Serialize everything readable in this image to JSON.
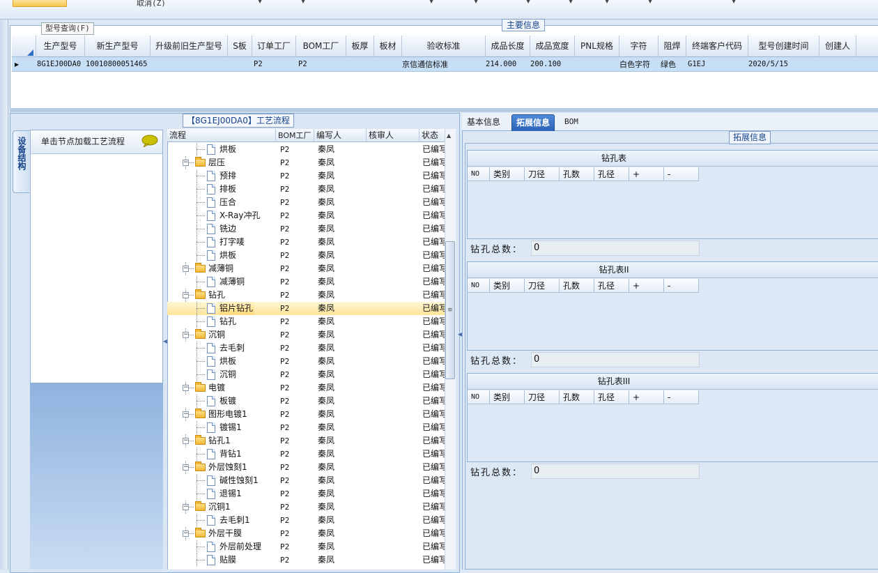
{
  "toolbar": {
    "cancel_label": "取消(Z)"
  },
  "main_group": {
    "title": "主要信息",
    "query_tab": "型号查询(F)",
    "columns": [
      "生产型号",
      "新生产型号",
      "升级前旧生产型号",
      "S板",
      "订单工厂",
      "BOM工厂",
      "板厚",
      "板材",
      "验收标准",
      "成品长度",
      "成品宽度",
      "PNL规格",
      "字符",
      "阻焊",
      "终端客户代码",
      "型号创建时间",
      "创建人"
    ],
    "row": {
      "prod_model": "8G1EJ00DA0",
      "new_model": "10010800051465",
      "old_model": "",
      "s_board": "",
      "order_factory": "P2",
      "bom_factory": "P2",
      "thickness": "",
      "material": "",
      "standard": "京信通信标准",
      "length": "214.000",
      "width": "200.100",
      "pnl": "",
      "char": "白色字符",
      "mask": "绿色",
      "customer": "G1EJ",
      "created": "2020/5/15",
      "creator": ""
    }
  },
  "left_panel": {
    "flow_title": "【8G1EJ00DA0】工艺流程",
    "vertical_tab": "设备结构",
    "node_hint": "单击节点加载工艺流程"
  },
  "tree": {
    "columns": [
      "流程",
      "BOM工厂",
      "编写人",
      "核审人",
      "状态"
    ],
    "rows": [
      {
        "name": "烘板",
        "level": 2,
        "bom": "P2",
        "author": "秦凤",
        "status": "已编写"
      },
      {
        "name": "层压",
        "level": 1,
        "bom": "P2",
        "author": "秦凤",
        "status": "已编写"
      },
      {
        "name": "预排",
        "level": 2,
        "bom": "P2",
        "author": "秦凤",
        "status": "已编写"
      },
      {
        "name": "排板",
        "level": 2,
        "bom": "P2",
        "author": "秦凤",
        "status": "已编写"
      },
      {
        "name": "压合",
        "level": 2,
        "bom": "P2",
        "author": "秦凤",
        "status": "已编写"
      },
      {
        "name": "X-Ray冲孔",
        "level": 2,
        "bom": "P2",
        "author": "秦凤",
        "status": "已编写"
      },
      {
        "name": "铣边",
        "level": 2,
        "bom": "P2",
        "author": "秦凤",
        "status": "已编写"
      },
      {
        "name": "打字唛",
        "level": 2,
        "bom": "P2",
        "author": "秦凤",
        "status": "已编写"
      },
      {
        "name": "烘板",
        "level": 2,
        "bom": "P2",
        "author": "秦凤",
        "status": "已编写"
      },
      {
        "name": "减薄铜",
        "level": 1,
        "bom": "P2",
        "author": "秦凤",
        "status": "已编写"
      },
      {
        "name": "减薄铜",
        "level": 2,
        "bom": "P2",
        "author": "秦凤",
        "status": "已编写"
      },
      {
        "name": "钻孔",
        "level": 1,
        "bom": "P2",
        "author": "秦凤",
        "status": "已编写"
      },
      {
        "name": "铝片钻孔",
        "level": 2,
        "bom": "P2",
        "author": "秦凤",
        "status": "已编写",
        "selected": true
      },
      {
        "name": "钻孔",
        "level": 2,
        "bom": "P2",
        "author": "秦凤",
        "status": "已编写"
      },
      {
        "name": "沉铜",
        "level": 1,
        "bom": "P2",
        "author": "秦凤",
        "status": "已编写"
      },
      {
        "name": "去毛刺",
        "level": 2,
        "bom": "P2",
        "author": "秦凤",
        "status": "已编写"
      },
      {
        "name": "烘板",
        "level": 2,
        "bom": "P2",
        "author": "秦凤",
        "status": "已编写"
      },
      {
        "name": "沉铜",
        "level": 2,
        "bom": "P2",
        "author": "秦凤",
        "status": "已编写"
      },
      {
        "name": "电镀",
        "level": 1,
        "bom": "P2",
        "author": "秦凤",
        "status": "已编写"
      },
      {
        "name": "板镀",
        "level": 2,
        "bom": "P2",
        "author": "秦凤",
        "status": "已编写"
      },
      {
        "name": "图形电镀1",
        "level": 1,
        "bom": "P2",
        "author": "秦凤",
        "status": "已编写"
      },
      {
        "name": "镀锡1",
        "level": 2,
        "bom": "P2",
        "author": "秦凤",
        "status": "已编写"
      },
      {
        "name": "钻孔1",
        "level": 1,
        "bom": "P2",
        "author": "秦凤",
        "status": "已编写"
      },
      {
        "name": "背钻1",
        "level": 2,
        "bom": "P2",
        "author": "秦凤",
        "status": "已编写"
      },
      {
        "name": "外层蚀刻1",
        "level": 1,
        "bom": "P2",
        "author": "秦凤",
        "status": "已编写"
      },
      {
        "name": "碱性蚀刻1",
        "level": 2,
        "bom": "P2",
        "author": "秦凤",
        "status": "已编写"
      },
      {
        "name": "退锡1",
        "level": 2,
        "bom": "P2",
        "author": "秦凤",
        "status": "已编写"
      },
      {
        "name": "沉铜1",
        "level": 1,
        "bom": "P2",
        "author": "秦凤",
        "status": "已编写"
      },
      {
        "name": "去毛刺1",
        "level": 2,
        "bom": "P2",
        "author": "秦凤",
        "status": "已编写"
      },
      {
        "name": "外层干膜",
        "level": 1,
        "bom": "P2",
        "author": "秦凤",
        "status": "已编写"
      },
      {
        "name": "外层前处理",
        "level": 2,
        "bom": "P2",
        "author": "秦凤",
        "status": "已编写"
      },
      {
        "name": "贴膜",
        "level": 2,
        "bom": "P2",
        "author": "秦凤",
        "status": "已编写"
      }
    ]
  },
  "right_panel": {
    "tabs": [
      "基本信息",
      "拓展信息",
      "BOM"
    ],
    "active_tab": "拓展信息",
    "group_title": "拓展信息",
    "table_columns": [
      "NO",
      "类别",
      "刀径",
      "孔数",
      "孔径",
      "+",
      "-"
    ],
    "total_label": "钻孔总数：",
    "tables": [
      {
        "title": "钻孔表",
        "total": "0"
      },
      {
        "title": "钻孔表II",
        "total": "0"
      },
      {
        "title": "钻孔表III",
        "total": "0"
      }
    ]
  }
}
